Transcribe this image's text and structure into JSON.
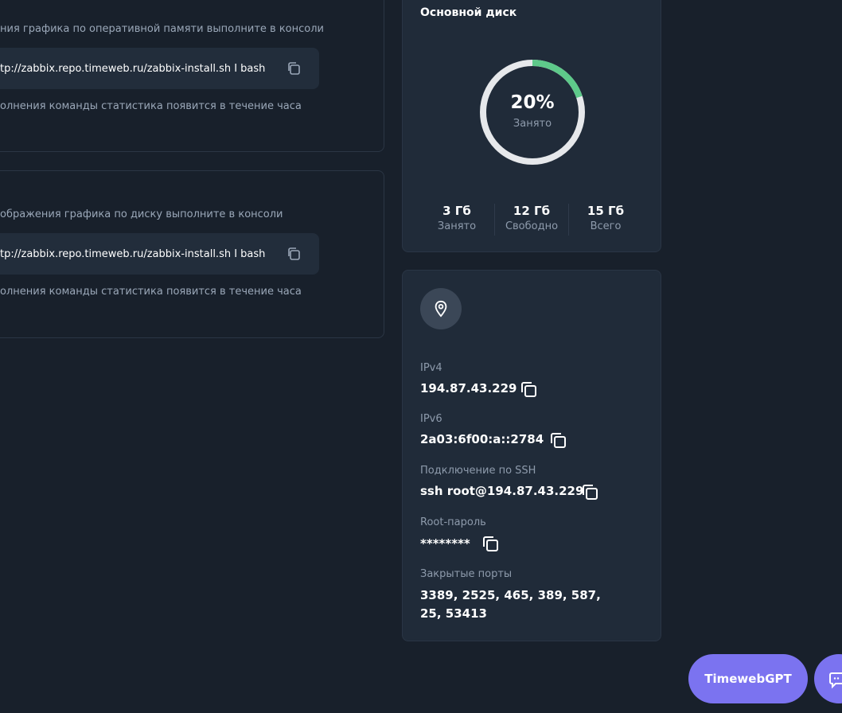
{
  "ram_card": {
    "hint": "ния графика по оперативной памяти выполните в консоли",
    "command": "tp://zabbix.repo.timeweb.ru/zabbix-install.sh I bash",
    "note": "олнения команды статистика появится в течение часа"
  },
  "disk_card": {
    "hint": "ображения графика по диску выполните в консоли",
    "command": "tp://zabbix.repo.timeweb.ru/zabbix-install.sh I bash",
    "note": "олнения команды статистика появится в течение часа"
  },
  "main_disk": {
    "title": "Основной диск",
    "percent_label": "20%",
    "percent_value": 20,
    "percent_sub": "Занято",
    "stats": [
      {
        "value": "3 Гб",
        "label": "Занято"
      },
      {
        "value": "12 Гб",
        "label": "Свободно"
      },
      {
        "value": "15 Гб",
        "label": "Всего"
      }
    ],
    "colors": {
      "used": "#5ec98a",
      "free": "#e6e8eb"
    }
  },
  "network": {
    "ipv4_label": "IPv4",
    "ipv4_value": "194.87.43.229",
    "ipv6_label": "IPv6",
    "ipv6_value": "2a03:6f00:a::2784",
    "ssh_label": "Подключение по SSH",
    "ssh_value": "ssh root@194.87.43.229",
    "root_label": "Root-пароль",
    "root_value": "********",
    "ports_label": "Закрытые порты",
    "ports_line1": "3389, 2525, 465, 389, 587,",
    "ports_line2": "25, 53413"
  },
  "floating": {
    "gpt_label": "TimewebGPT",
    "accent": "#7b73f0"
  }
}
